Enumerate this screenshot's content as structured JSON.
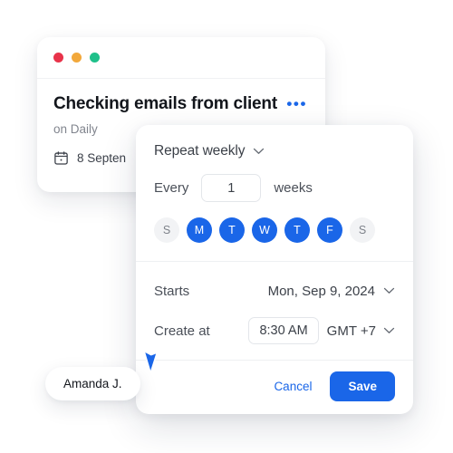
{
  "window_controls": {
    "close_color": "#e8334a",
    "minimize_color": "#f2a83b",
    "maximize_color": "#1fc08a"
  },
  "task_card": {
    "title": "Checking emails from client",
    "subtitle": "on Daily",
    "date": "8 Septen",
    "menu_label": "•••",
    "calendar_icon": "calendar-icon"
  },
  "repeat_dialog": {
    "repeat_label": "Repeat weekly",
    "every_label": "Every",
    "interval_value": "1",
    "unit_label": "weeks",
    "days": [
      {
        "letter": "S",
        "name": "sunday",
        "selected": false
      },
      {
        "letter": "M",
        "name": "monday",
        "selected": true
      },
      {
        "letter": "T",
        "name": "tuesday",
        "selected": true
      },
      {
        "letter": "W",
        "name": "wednesday",
        "selected": true
      },
      {
        "letter": "T",
        "name": "thursday",
        "selected": true
      },
      {
        "letter": "F",
        "name": "friday",
        "selected": true
      },
      {
        "letter": "S",
        "name": "saturday",
        "selected": false
      }
    ],
    "starts_label": "Starts",
    "starts_value": "Mon, Sep 9, 2024",
    "create_at_label": "Create at",
    "time_value": "8:30 AM",
    "timezone_value": "GMT +7",
    "cancel_label": "Cancel",
    "save_label": "Save",
    "accent_color": "#1a66e8"
  },
  "presence": {
    "user_name": "Amanda J.",
    "cursor_color": "#1a66e8"
  }
}
